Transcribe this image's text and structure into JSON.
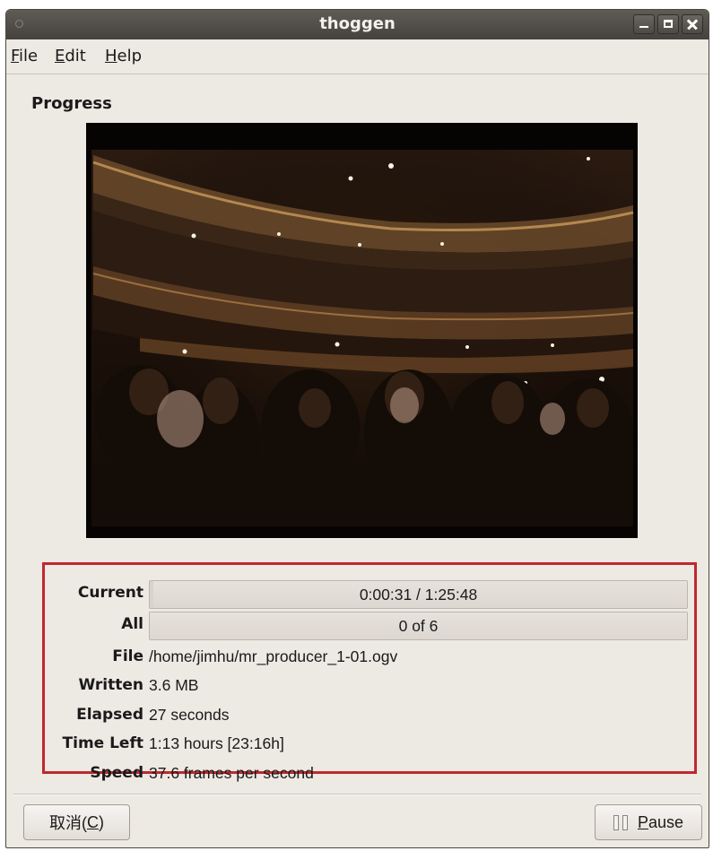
{
  "window": {
    "title": "thoggen"
  },
  "menu": [
    {
      "mnemonic": "F",
      "rest": "ile"
    },
    {
      "mnemonic": "E",
      "rest": "dit"
    },
    {
      "mnemonic": "H",
      "rest": "elp"
    }
  ],
  "section_title": "Progress",
  "preview": {
    "description": "video frame preview"
  },
  "progress": {
    "current": {
      "label": "Current",
      "text": "0:00:31 / 1:25:48",
      "fraction": 0.006
    },
    "all": {
      "label": "All",
      "text": "0 of 6",
      "fraction": 0.0
    },
    "file": {
      "label": "File",
      "value": "/home/jimhu/mr_producer_1-01.ogv"
    },
    "written": {
      "label": "Written",
      "value": "3.6 MB"
    },
    "elapsed": {
      "label": "Elapsed",
      "value": "27 seconds"
    },
    "time_left": {
      "label": "Time Left",
      "value": "1:13 hours [23:16h]"
    },
    "speed": {
      "label": "Speed",
      "value": "37.6 frames per second"
    }
  },
  "buttons": {
    "cancel": {
      "prefix": "取消(",
      "mnemonic": "C",
      "suffix": ")"
    },
    "pause": {
      "mnemonic": "P",
      "rest": "ause",
      "icon": "pause-icon"
    }
  },
  "colors": {
    "highlight_border": "#c0282d",
    "window_bg": "#ede9e3"
  }
}
